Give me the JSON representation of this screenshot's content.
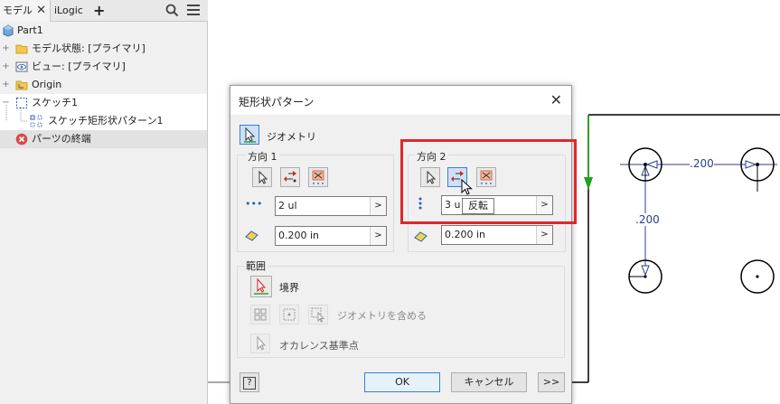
{
  "browser": {
    "tabs": {
      "model": "モデル",
      "ilogic": "iLogic",
      "add": "+"
    },
    "tree": [
      {
        "label": "Part1"
      },
      {
        "label": "モデル状態: [プライマリ]"
      },
      {
        "label": "ビュー: [プライマリ]"
      },
      {
        "label": "Origin"
      },
      {
        "label": "スケッチ1"
      },
      {
        "label": "スケッチ矩形状パターン1"
      },
      {
        "label": "パーツの終端"
      }
    ]
  },
  "canvas": {
    "dim_horizontal": ".200",
    "dim_vertical": ".200"
  },
  "dialog": {
    "title": "矩形状パターン",
    "geometry_label": "ジオメトリ",
    "dir1": {
      "label": "方向 1",
      "count": "2 ul",
      "spacing": "0.200 in"
    },
    "dir2": {
      "label": "方向 2",
      "count": "3 u",
      "spacing": "0.200 in"
    },
    "extent": {
      "label": "範囲",
      "boundary_label": "境界",
      "include_geometry_label": "ジオメトリを含める",
      "occurrence_label": "オカレンス基準点"
    },
    "tooltip": "反転",
    "help": "?",
    "ok": "OK",
    "cancel": "キャンセル",
    "more": ">>"
  },
  "colors": {
    "highlight_box": "#e0282b",
    "axis_green": "#1aa51a",
    "dimension": "#2a3e8c"
  }
}
